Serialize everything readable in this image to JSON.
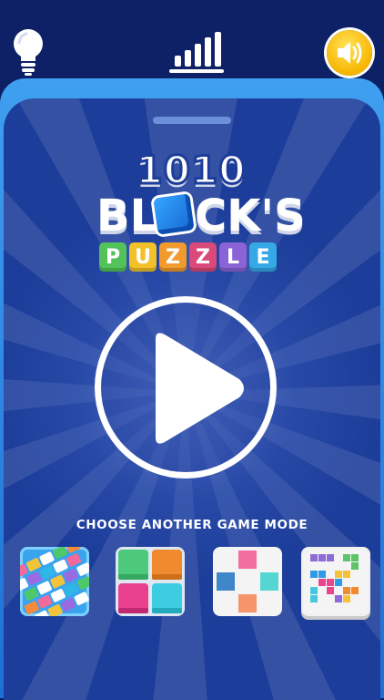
{
  "toolbar": {
    "hint_icon": "lightbulb-icon",
    "stats_icon": "bar-chart-icon",
    "sound_icon": "speaker-icon"
  },
  "logo": {
    "line1": "1010",
    "line2_left": "BL",
    "line2_right": "CK'S",
    "line3_letters": [
      "P",
      "U",
      "Z",
      "Z",
      "L",
      "E"
    ],
    "line3_colors": [
      "#53c25a",
      "#f2c12a",
      "#f29a2e",
      "#d9497a",
      "#8a64d6",
      "#35a9e6"
    ]
  },
  "play": {
    "icon": "play-icon"
  },
  "modes": {
    "heading": "CHOOSE ANOTHER GAME MODE",
    "items": [
      {
        "icon": "diagonal-blocks-mode-icon"
      },
      {
        "icon": "four-squares-mode-icon"
      },
      {
        "icon": "plus-cross-mode-icon"
      },
      {
        "icon": "tetris-grid-mode-icon"
      }
    ]
  },
  "colors": {
    "background": "#0d1f63",
    "panel": "#1d3d9a",
    "frame": "#2f86e6",
    "sound_button": "#f7b500"
  }
}
